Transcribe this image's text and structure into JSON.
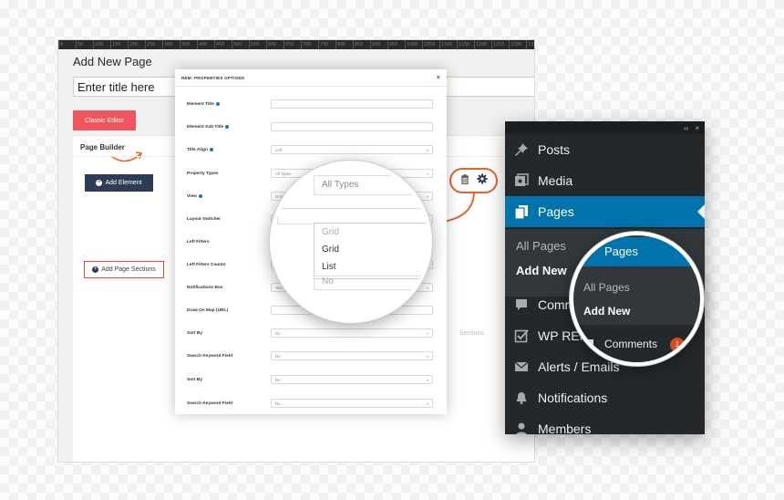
{
  "ruler": {
    "ticks": [
      "0",
      "50",
      "100",
      "150",
      "200",
      "250",
      "300",
      "350",
      "400",
      "450",
      "500",
      "550",
      "600",
      "650",
      "700",
      "750",
      "800",
      "850",
      "900",
      "950",
      "1000",
      "1050",
      "1100",
      "1150",
      "1200",
      "1250",
      "1300",
      "1350",
      "1400",
      "1450",
      "1500",
      "1550",
      "1600"
    ]
  },
  "editor": {
    "heading": "Add New Page",
    "title_value": "Enter title here",
    "classic_editor_label": "Classic Editor",
    "page_builder_label": "Page Builder",
    "add_element_label": "Add Element",
    "add_sections_label": "Add Page Sections",
    "ghost_sections_text": "Sections"
  },
  "modal": {
    "title": "REM: PROPERTIES OPTIONS",
    "close": "×",
    "rows": [
      {
        "label": "Element Title",
        "info": true,
        "type": "text",
        "value": ""
      },
      {
        "label": "Element Sub Title",
        "info": true,
        "type": "text",
        "value": ""
      },
      {
        "label": "Title Align",
        "info": true,
        "type": "select",
        "value": "Left"
      },
      {
        "label": "Property Types",
        "info": false,
        "type": "select",
        "value": "All Types"
      },
      {
        "label": "View",
        "info": true,
        "type": "select",
        "value": "Grid"
      },
      {
        "label": "Layout Switcher",
        "info": false,
        "type": "select",
        "value": ""
      },
      {
        "label": "Left Filters",
        "info": false,
        "type": "select",
        "value": ""
      },
      {
        "label": "Left Filters Counts",
        "info": false,
        "type": "select",
        "value": ""
      },
      {
        "label": "Notifications Box",
        "info": false,
        "type": "select",
        "value": "Yes"
      },
      {
        "label": "Draw On Map (URL)",
        "info": false,
        "type": "text",
        "value": ""
      },
      {
        "label": "Sort By",
        "info": false,
        "type": "select",
        "value": "No"
      },
      {
        "label": "Search Keyword Field",
        "info": false,
        "type": "select",
        "value": "No"
      },
      {
        "label": "Sort By",
        "info": false,
        "type": "select",
        "value": "No"
      },
      {
        "label": "Search Keyword Field",
        "info": false,
        "type": "select",
        "value": "No"
      }
    ]
  },
  "magnifier_left": {
    "property_types_value": "All Types",
    "view_options": [
      "Grid",
      "Grid",
      "List"
    ],
    "below_value": "No"
  },
  "wp_menu": {
    "top_icons": [
      "collapse-icon",
      "close-icon"
    ],
    "items": [
      {
        "label": "Posts",
        "icon": "pin-icon"
      },
      {
        "label": "Media",
        "icon": "media-icon"
      },
      {
        "label": "Pages",
        "icon": "pages-icon"
      },
      {
        "label": "Comments",
        "icon": "comments-icon"
      },
      {
        "label": "WP REM",
        "icon": "checkbox-icon"
      },
      {
        "label": "Alerts / Emails",
        "icon": "envelope-icon"
      },
      {
        "label": "Notifications",
        "icon": "bell-icon"
      },
      {
        "label": "Members",
        "icon": "members-icon"
      }
    ],
    "submenu": [
      "All Pages",
      "Add New"
    ]
  },
  "magnifier_right": {
    "pages_label": "Pages",
    "sub": [
      "All Pages",
      "Add New"
    ],
    "comments_label": "Comments",
    "comments_badge": "1"
  },
  "colors": {
    "accent_red": "#f0545c",
    "accent_orange": "#e0662f",
    "wp_dark": "#23282d",
    "wp_blue": "#0073aa",
    "navy_button": "#2f3c57"
  }
}
